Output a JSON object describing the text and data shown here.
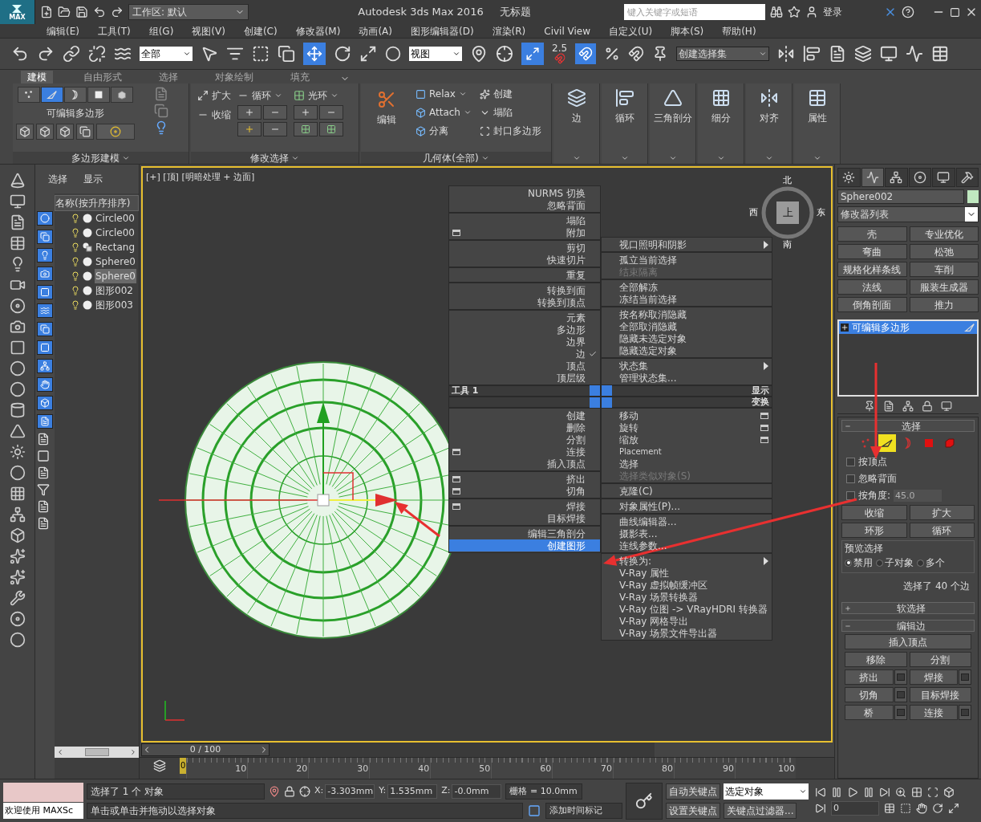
{
  "title_bar": {
    "logo_text": "MAX",
    "workspace": "工作区: 默认",
    "title": "Autodesk 3ds Max 2016",
    "document": "无标题",
    "search": {
      "placeholder": "键入关键字或短语"
    },
    "login": "登录"
  },
  "menu_bar": [
    "编辑(E)",
    "工具(T)",
    "组(G)",
    "视图(V)",
    "创建(C)",
    "修改器(M)",
    "动画(A)",
    "图形编辑器(D)",
    "渲染(R)",
    "Civil View",
    "自定义(U)",
    "脚本(S)",
    "帮助(H)"
  ],
  "main_toolbar": {
    "filter": "全部",
    "coordinate": "视图",
    "snap_label": "2.5",
    "selection_set": "创建选择集"
  },
  "ribbon": {
    "tabs": [
      {
        "label": "建模",
        "selected": true
      },
      {
        "label": "自由形式",
        "selected": false
      },
      {
        "label": "选择",
        "selected": false
      },
      {
        "label": "对象绘制",
        "selected": false
      },
      {
        "label": "填充",
        "selected": false
      }
    ],
    "polygon_modeling": {
      "label": "可编辑多边形",
      "footer": "多边形建模",
      "subobjects": [
        {
          "kind": "vertex",
          "selected": false
        },
        {
          "kind": "edge",
          "selected": true
        },
        {
          "kind": "border",
          "selected": false
        },
        {
          "kind": "polygon",
          "selected": false
        },
        {
          "kind": "element",
          "selected": false
        }
      ]
    },
    "modify_selection": {
      "grow": "扩大",
      "shrink": "收缩",
      "loop": "循环",
      "ring": "光环",
      "footer": "修改选择"
    },
    "geometry": {
      "edit": "编辑",
      "relax": "Relax",
      "attach": "Attach",
      "detach": "分离",
      "create": "创建",
      "collapse": "塌陷",
      "cap": "封口多边形",
      "footer": "几何体(全部)"
    },
    "big_buttons": [
      "边",
      "循环",
      "三角剖分",
      "细分",
      "对齐",
      "属性"
    ]
  },
  "scene_explorer": {
    "tabs": [
      "选择",
      "显示"
    ],
    "column": "名称(按升序排序)",
    "items": [
      {
        "name": "Circle00",
        "kind": "object",
        "selected": false
      },
      {
        "name": "Circle00",
        "kind": "object",
        "selected": false
      },
      {
        "name": "Rectang",
        "kind": "spline",
        "selected": false
      },
      {
        "name": "Sphere0",
        "kind": "object",
        "selected": false
      },
      {
        "name": "Sphere0",
        "kind": "object",
        "selected": true
      },
      {
        "name": "图形002",
        "kind": "object",
        "selected": false
      },
      {
        "name": "图形003",
        "kind": "object",
        "selected": false
      }
    ]
  },
  "viewport": {
    "label": "[+] [顶] [明暗处理 + 边面]",
    "viewcube": {
      "north": "北",
      "south": "南",
      "west": "西",
      "east": "东",
      "face": "上"
    }
  },
  "quad_menu": {
    "left_upper": [
      [
        {
          "label": "NURMS 切换",
          "kind": "plain",
          "selected": false
        },
        {
          "label": "忽略背面",
          "kind": "plain",
          "selected": false
        }
      ],
      [
        {
          "label": "塌陷",
          "kind": "plain",
          "selected": false
        },
        {
          "label": "附加",
          "kind": "settings",
          "selected": false
        }
      ],
      [
        {
          "label": "剪切",
          "kind": "plain",
          "selected": false
        },
        {
          "label": "快速切片",
          "kind": "plain",
          "selected": false
        }
      ],
      [
        {
          "label": "重复",
          "kind": "plain",
          "selected": false
        }
      ],
      [
        {
          "label": "转换到面",
          "kind": "plain",
          "selected": false
        },
        {
          "label": "转换到顶点",
          "kind": "plain",
          "selected": false
        }
      ],
      [
        {
          "label": "元素",
          "kind": "unchecked",
          "selected": false
        },
        {
          "label": "多边形",
          "kind": "unchecked",
          "selected": false
        },
        {
          "label": "边界",
          "kind": "unchecked",
          "selected": false
        },
        {
          "label": "边",
          "kind": "checked",
          "selected": false
        },
        {
          "label": "顶点",
          "kind": "unchecked",
          "selected": false
        },
        {
          "label": "顶层级",
          "kind": "unchecked",
          "selected": false
        }
      ]
    ],
    "right_upper": [
      [
        {
          "label": "视口照明和阴影",
          "kind": "submenu",
          "selected": false
        }
      ],
      [
        {
          "label": "孤立当前选择",
          "kind": "plain",
          "selected": false
        },
        {
          "label": "结束隔离",
          "kind": "disabled",
          "selected": false
        }
      ],
      [
        {
          "label": "全部解冻",
          "kind": "plain",
          "selected": false
        },
        {
          "label": "冻结当前选择",
          "kind": "plain",
          "selected": false
        }
      ],
      [
        {
          "label": "按名称取消隐藏",
          "kind": "plain",
          "selected": false
        },
        {
          "label": "全部取消隐藏",
          "kind": "plain",
          "selected": false
        },
        {
          "label": "隐藏未选定对象",
          "kind": "plain",
          "selected": false
        },
        {
          "label": "隐藏选定对象",
          "kind": "plain",
          "selected": false
        }
      ],
      [
        {
          "label": "状态集",
          "kind": "submenu",
          "selected": false
        },
        {
          "label": "管理状态集...",
          "kind": "plain",
          "selected": false
        }
      ]
    ],
    "headers": {
      "left": "工具 1",
      "right_top": "显示",
      "right_bottom": "变换"
    },
    "left_lower": [
      [
        {
          "label": "创建",
          "kind": "plain",
          "selected": false
        },
        {
          "label": "删除",
          "kind": "plain",
          "selected": false
        },
        {
          "label": "分割",
          "kind": "plain",
          "selected": false
        },
        {
          "label": "连接",
          "kind": "settings",
          "selected": false
        },
        {
          "label": "插入顶点",
          "kind": "plain",
          "selected": false
        }
      ],
      [
        {
          "label": "挤出",
          "kind": "settings",
          "selected": false
        },
        {
          "label": "切角",
          "kind": "settings",
          "selected": false
        }
      ],
      [
        {
          "label": "焊接",
          "kind": "settings",
          "selected": false
        },
        {
          "label": "目标焊接",
          "kind": "plain",
          "selected": false
        }
      ],
      [
        {
          "label": "编辑三角剖分",
          "kind": "plain",
          "selected": false
        },
        {
          "label": "创建图形",
          "kind": "plain",
          "selected": true
        }
      ]
    ],
    "right_lower": [
      [
        {
          "label": "移动",
          "kind": "settings",
          "selected": false
        },
        {
          "label": "旋转",
          "kind": "settings",
          "selected": false
        },
        {
          "label": "缩放",
          "kind": "settings",
          "selected": false
        },
        {
          "label": "Placement",
          "kind": "small",
          "selected": false
        },
        {
          "label": "选择",
          "kind": "plain",
          "selected": false
        },
        {
          "label": "选择类似对象(S)",
          "kind": "disabled",
          "selected": false
        }
      ],
      [
        {
          "label": "克隆(C)",
          "kind": "plain",
          "selected": false
        }
      ],
      [
        {
          "label": "对象属性(P)...",
          "kind": "plain",
          "selected": false
        }
      ],
      [
        {
          "label": "曲线编辑器...",
          "kind": "plain",
          "selected": false
        },
        {
          "label": "摄影表...",
          "kind": "plain",
          "selected": false
        },
        {
          "label": "连线参数...",
          "kind": "plain",
          "selected": false
        }
      ],
      [
        {
          "label": "转换为:",
          "kind": "submenu",
          "selected": false
        },
        {
          "label": "V-Ray 属性",
          "kind": "plain",
          "selected": false
        },
        {
          "label": "V-Ray 虚拟帧缓冲区",
          "kind": "plain",
          "selected": false
        },
        {
          "label": "V-Ray 场景转换器",
          "kind": "plain",
          "selected": false
        },
        {
          "label": "V-Ray 位图 -> VRayHDRI 转换器",
          "kind": "plain",
          "selected": false
        },
        {
          "label": "V-Ray 网格导出",
          "kind": "plain",
          "selected": false
        },
        {
          "label": "V-Ray 场景文件导出器",
          "kind": "plain",
          "selected": false
        }
      ]
    ]
  },
  "command_panel": {
    "tabs": [
      {
        "kind": "create",
        "selected": false
      },
      {
        "kind": "modify",
        "selected": true
      },
      {
        "kind": "hierarchy",
        "selected": false
      },
      {
        "kind": "motion",
        "selected": false
      },
      {
        "kind": "display",
        "selected": false
      },
      {
        "kind": "utilities",
        "selected": false
      }
    ],
    "object_name": "Sphere002",
    "modifier_list": "修改器列表",
    "modifiers": [
      "壳",
      "专业优化",
      "弯曲",
      "松弛",
      "规格化样条线",
      "车削",
      "法线",
      "服装生成器",
      "倒角剖面",
      "推力"
    ],
    "stack": [
      {
        "label": "可编辑多边形",
        "selected": true
      }
    ],
    "selection": {
      "title": "选择",
      "subobjects": [
        {
          "kind": "vertex",
          "selected": false
        },
        {
          "kind": "edge",
          "selected": true
        },
        {
          "kind": "border",
          "selected": false
        },
        {
          "kind": "polygon",
          "selected": false
        },
        {
          "kind": "element",
          "selected": false
        }
      ],
      "checkboxes": [
        {
          "label": "按顶点",
          "checked": false
        },
        {
          "label": "忽略背面",
          "checked": false
        }
      ],
      "by_angle": {
        "label": "按角度:",
        "checked": false,
        "value": "45.0"
      },
      "shrink": "收缩",
      "grow": "扩大",
      "ring": "环形",
      "loop": "循环",
      "preview": {
        "label": "预览选择",
        "options": [
          {
            "label": "禁用",
            "selected": true
          },
          {
            "label": "子对象",
            "selected": false
          },
          {
            "label": "多个",
            "selected": false
          }
        ]
      },
      "status": "选择了 40 个边"
    },
    "rollouts": [
      {
        "title": "软选择",
        "expanded": false
      },
      {
        "title": "编辑边",
        "expanded": true
      }
    ],
    "edit_edges": {
      "insert_vertex": "插入顶点",
      "buttons": [
        {
          "label": "移除",
          "settings": false
        },
        {
          "label": "分割",
          "settings": false
        },
        {
          "label": "挤出",
          "settings": true
        },
        {
          "label": "焊接",
          "settings": true
        },
        {
          "label": "切角",
          "settings": true
        },
        {
          "label": "目标焊接",
          "settings": false
        },
        {
          "label": "桥",
          "settings": true
        },
        {
          "label": "连接",
          "settings": true
        }
      ]
    }
  },
  "timeline": {
    "frame": "0 / 100",
    "ticks": [
      "10",
      "20",
      "30",
      "40",
      "50",
      "60",
      "70",
      "80",
      "90",
      "100"
    ],
    "current": "0"
  },
  "status_bar": {
    "welcome": "欢迎使用 MAXSc",
    "selection": "选择了 1 个 对象",
    "prompt": "单击或单击并拖动以选择对象",
    "coordinates": [
      {
        "axis": "X:",
        "value": "-3.303mm"
      },
      {
        "axis": "Y:",
        "value": "1.535mm"
      },
      {
        "axis": "Z:",
        "value": "-0.0mm"
      }
    ],
    "grid": "栅格 = 10.0mm",
    "add_tag": "添加时间标记",
    "auto_key": "自动关键点",
    "set_key": "设置关键点",
    "key_mode": "选定对象",
    "key_filters": "关键点过滤器...",
    "frame": "0"
  }
}
